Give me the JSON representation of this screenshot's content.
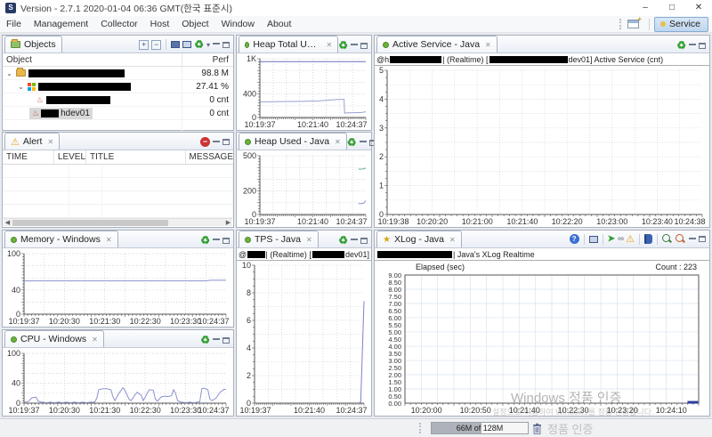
{
  "window": {
    "title": "Version - 2.7.1 2020-01-04 06:36 GMT(한국 표준시)"
  },
  "menu": {
    "items": [
      "File",
      "Management",
      "Collector",
      "Host",
      "Object",
      "Window",
      "About"
    ]
  },
  "perspective": {
    "service_label": "Service"
  },
  "objects_panel": {
    "tab": "Objects",
    "columns": {
      "object": "Object",
      "perf": "Perf"
    },
    "rows": [
      {
        "perf": "98.8 M"
      },
      {
        "perf": "27.41 %"
      },
      {
        "perf": "0 cnt"
      },
      {
        "label_suffix": "hdev01",
        "perf": "0 cnt"
      }
    ]
  },
  "alert_panel": {
    "tab": "Alert",
    "columns": [
      "TIME",
      "LEVEL",
      "TITLE",
      "MESSAGE"
    ]
  },
  "status_bar": {
    "memory_label": "66M of 128M"
  },
  "watermark": {
    "line1": "Windows 정품 인증",
    "line2": "설정으로 이동하여 Windows를 정품 인증합니다.",
    "line3": "정품 인증"
  },
  "chart_data": {
    "memory": {
      "type": "line",
      "title": "Memory - Windows",
      "ylim": [
        0,
        100
      ],
      "yticks": [
        {
          "v": 0,
          "t": "0"
        },
        {
          "v": 40,
          "t": "40"
        },
        {
          "v": 100,
          "t": "100"
        }
      ],
      "xlabels": [
        {
          "p": 0,
          "t": "10:19:37"
        },
        {
          "p": 0.2,
          "t": "10:20:30"
        },
        {
          "p": 0.4,
          "t": "10:21:30"
        },
        {
          "p": 0.6,
          "t": "10:22:30"
        },
        {
          "p": 0.8,
          "t": "10:23:30"
        },
        {
          "p": 1,
          "t": "10:24:37"
        }
      ],
      "margins": {
        "l": 24,
        "r": 8,
        "t": 6,
        "b": 14
      },
      "grid": {
        "vx": [
          0.1,
          0.2,
          0.3,
          0.4,
          0.5,
          0.6,
          0.7,
          0.8,
          0.9
        ],
        "hy": [
          0.2,
          0.4,
          0.6,
          0.8,
          1
        ],
        "color": "#cbcbcb",
        "dash": "1,2"
      },
      "minor_x": true,
      "minor_y": true,
      "series": [
        {
          "name": "memory-used-percent",
          "color": "#8a93cc",
          "lw": 1,
          "x": [
            0,
            0.9,
            0.92,
            1
          ],
          "y": [
            55,
            55,
            56,
            56
          ]
        }
      ]
    },
    "cpu": {
      "type": "line",
      "title": "CPU - Windows",
      "ylim": [
        0,
        100
      ],
      "yticks": [
        {
          "v": 0,
          "t": "0"
        },
        {
          "v": 40,
          "t": "40"
        },
        {
          "v": 100,
          "t": "100"
        }
      ],
      "xlabels": [
        {
          "p": 0,
          "t": "10:19:37"
        },
        {
          "p": 0.2,
          "t": "10:20:30"
        },
        {
          "p": 0.4,
          "t": "10:21:30"
        },
        {
          "p": 0.6,
          "t": "10:22:30"
        },
        {
          "p": 0.8,
          "t": "10:23:30"
        },
        {
          "p": 1,
          "t": "10:24:37"
        }
      ],
      "margins": {
        "l": 24,
        "r": 8,
        "t": 6,
        "b": 14
      },
      "grid": {
        "vx": [
          0.1,
          0.2,
          0.3,
          0.4,
          0.5,
          0.6,
          0.7,
          0.8,
          0.9
        ],
        "hy": [
          0.2,
          0.4,
          0.6,
          0.8,
          1
        ],
        "color": "#cbcbcb",
        "dash": "1,2"
      },
      "minor_x": true,
      "minor_y": true,
      "series": [
        {
          "name": "cpu-percent",
          "color": "#8a93cc",
          "lw": 1,
          "x": [
            0,
            0.02,
            0.04,
            0.06,
            0.07,
            0.09,
            0.11,
            0.13,
            0.15,
            0.17,
            0.19,
            0.21,
            0.23,
            0.25,
            0.27,
            0.29,
            0.31,
            0.33,
            0.35,
            0.36,
            0.37,
            0.39,
            0.41,
            0.43,
            0.44,
            0.45,
            0.47,
            0.49,
            0.5,
            0.52,
            0.53,
            0.55,
            0.56,
            0.58,
            0.59,
            0.61,
            0.62,
            0.64,
            0.65,
            0.66,
            0.68,
            0.7,
            0.71,
            0.73,
            0.74,
            0.75,
            0.76,
            0.78,
            0.8,
            0.82,
            0.84,
            0.86,
            0.87,
            0.88,
            0.89,
            0.91,
            0.92,
            0.93,
            0.95,
            0.97,
            0.99,
            1
          ],
          "y": [
            2,
            3,
            11,
            12,
            4,
            2,
            1,
            2,
            1,
            2,
            1,
            2,
            1,
            2,
            1,
            2,
            1,
            2,
            2,
            10,
            27,
            29,
            29,
            27,
            13,
            5,
            20,
            31,
            25,
            8,
            5,
            17,
            22,
            16,
            5,
            20,
            27,
            26,
            8,
            4,
            13,
            14,
            13,
            15,
            27,
            20,
            5,
            2,
            1,
            2,
            1,
            2,
            3,
            29,
            30,
            27,
            8,
            5,
            10,
            22,
            28,
            27
          ]
        }
      ]
    },
    "heap_total": {
      "type": "line",
      "title": "Heap Total Usage - Java",
      "ylim": [
        0,
        1000
      ],
      "yticks": [
        {
          "v": 0,
          "t": "0"
        },
        {
          "v": 400,
          "t": "400"
        },
        {
          "v": 1000,
          "t": "1K"
        }
      ],
      "xlabels": [
        {
          "p": 0,
          "t": "10:19:37"
        },
        {
          "p": 0.5,
          "t": "10:21:40"
        },
        {
          "p": 1,
          "t": "10:24:37"
        }
      ],
      "margins": {
        "l": 26,
        "r": 6,
        "t": 6,
        "b": 14
      },
      "grid": {
        "vx": [
          0.125,
          0.25,
          0.375,
          0.5,
          0.625,
          0.75,
          0.875
        ],
        "hy": [
          0.2,
          0.4,
          0.6,
          0.8,
          1
        ],
        "color": "#cbcbcb",
        "dash": "1,2"
      },
      "minor_x": true,
      "minor_y": true,
      "series": [
        {
          "name": "heap-max",
          "color": "#6a74bd",
          "lw": 1,
          "x": [
            0,
            1
          ],
          "y": [
            950,
            950
          ]
        },
        {
          "name": "heap-total",
          "color": "#98a0d0",
          "lw": 1,
          "x": [
            0,
            0.2,
            0.4,
            0.55,
            0.65,
            0.72,
            0.78,
            0.795,
            0.8,
            0.81,
            0.9,
            0.96,
            1
          ],
          "y": [
            265,
            270,
            275,
            282,
            295,
            305,
            308,
            308,
            74,
            78,
            82,
            86,
            96
          ]
        }
      ]
    },
    "heap_used": {
      "type": "line",
      "title": "Heap Used - Java",
      "ylim": [
        0,
        500
      ],
      "yticks": [
        {
          "v": 0,
          "t": "0"
        },
        {
          "v": 200,
          "t": "200"
        },
        {
          "v": 500,
          "t": "500"
        }
      ],
      "xlabels": [
        {
          "p": 0,
          "t": "10:19:37"
        },
        {
          "p": 0.5,
          "t": "10:21:40"
        },
        {
          "p": 1,
          "t": "10:24:37"
        }
      ],
      "margins": {
        "l": 26,
        "r": 6,
        "t": 6,
        "b": 14
      },
      "grid": {
        "vx": [
          0.125,
          0.25,
          0.375,
          0.5,
          0.625,
          0.75,
          0.875
        ],
        "hy": [
          0.2,
          0.4,
          0.6,
          0.8,
          1
        ],
        "color": "#cbcbcb",
        "dash": "1,2"
      },
      "minor_x": true,
      "minor_y": true,
      "series": [
        {
          "name": "heap-used-a",
          "color": "#5fb39b",
          "lw": 1,
          "x": [
            0.93,
            0.97,
            1
          ],
          "y": [
            385,
            387,
            394
          ]
        },
        {
          "name": "heap-used-b",
          "color": "#8a93cc",
          "lw": 1,
          "x": [
            0.93,
            0.96,
            0.98,
            1
          ],
          "y": [
            93,
            93,
            96,
            118
          ]
        }
      ]
    },
    "tps": {
      "type": "line",
      "title": "TPS - Java",
      "subtitle": {
        "a": "@",
        "b": " | (Realtime) [",
        "c": "dev01]"
      },
      "ylim": [
        0,
        10
      ],
      "yticks": [
        {
          "v": 0,
          "t": "0"
        },
        {
          "v": 2,
          "t": "2"
        },
        {
          "v": 4,
          "t": "4"
        },
        {
          "v": 6,
          "t": "6"
        },
        {
          "v": 8,
          "t": "8"
        },
        {
          "v": 10,
          "t": "10"
        }
      ],
      "xlabels": [
        {
          "p": 0,
          "t": "10:19:37"
        },
        {
          "p": 0.5,
          "t": "10:21:40"
        },
        {
          "p": 1,
          "t": "10:24:37"
        }
      ],
      "margins": {
        "l": 20,
        "r": 8,
        "t": 5,
        "b": 14
      },
      "grid": {
        "vx": [
          0.125,
          0.25,
          0.375,
          0.5,
          0.625,
          0.75,
          0.875
        ],
        "hy": [
          0.1,
          0.2,
          0.3,
          0.4,
          0.5,
          0.6,
          0.7,
          0.8,
          0.9,
          1
        ],
        "color": "#d2d2d2",
        "dash": "1,2"
      },
      "minor_x": true,
      "minor_y": true,
      "series": [
        {
          "name": "tps",
          "color": "#7b84c4",
          "lw": 1,
          "x": [
            0.955,
            0.97,
            1
          ],
          "y": [
            0,
            0.1,
            7.4
          ]
        }
      ]
    },
    "active_service": {
      "type": "line",
      "title": "Active Service - Java",
      "subtitle": {
        "a": "@h",
        "b": " | (Realtime) [",
        "c": "dev01] Active Service (cnt)"
      },
      "ylim": [
        0,
        5
      ],
      "yticks": [
        {
          "v": 0,
          "t": "0"
        },
        {
          "v": 1,
          "t": "1"
        },
        {
          "v": 2,
          "t": "2"
        },
        {
          "v": 3,
          "t": "3"
        },
        {
          "v": 4,
          "t": "4"
        },
        {
          "v": 5,
          "t": "5"
        }
      ],
      "xlabels": [
        {
          "p": 0,
          "t": "10:19:38"
        },
        {
          "p": 0.143,
          "t": "10:20:20"
        },
        {
          "p": 0.286,
          "t": "10:21:00"
        },
        {
          "p": 0.429,
          "t": "10:21:40"
        },
        {
          "p": 0.571,
          "t": "10:22:20"
        },
        {
          "p": 0.714,
          "t": "10:23:00"
        },
        {
          "p": 0.857,
          "t": "10:23:40"
        },
        {
          "p": 1,
          "t": "10:24:38"
        }
      ],
      "margins": {
        "l": 14,
        "r": 8,
        "t": 5,
        "b": 14
      },
      "grid": {
        "vx": [
          0.0714,
          0.1429,
          0.2143,
          0.2857,
          0.3571,
          0.4286,
          0.5,
          0.5714,
          0.6429,
          0.7143,
          0.7857,
          0.8571,
          0.9286
        ],
        "hy": [
          0.1,
          0.2,
          0.3,
          0.4,
          0.5,
          0.6,
          0.7,
          0.8,
          0.9,
          1
        ],
        "color": "#d2d2d2",
        "dash": "1,2"
      },
      "minor_x": true,
      "minor_y": true,
      "series": []
    },
    "xlog": {
      "type": "scatter",
      "title": "XLog - Java",
      "subtitle": {
        "b": " | Java's XLog Realtime"
      },
      "elapsed_label": "Elapsed (sec)",
      "count_label": "Count : 223",
      "ylim": [
        0,
        9
      ],
      "yfs": 7.5,
      "box": true,
      "yticks": [
        {
          "v": 9,
          "t": "9.00"
        },
        {
          "v": 8.5,
          "t": "8.50"
        },
        {
          "v": 8,
          "t": "8.00"
        },
        {
          "v": 7.5,
          "t": "7.50"
        },
        {
          "v": 7,
          "t": "7.00"
        },
        {
          "v": 6.5,
          "t": "6.50"
        },
        {
          "v": 6,
          "t": "6.00"
        },
        {
          "v": 5.5,
          "t": "5.50"
        },
        {
          "v": 5,
          "t": "5.00"
        },
        {
          "v": 4.5,
          "t": "4.50"
        },
        {
          "v": 4,
          "t": "4.00"
        },
        {
          "v": 3.5,
          "t": "3.50"
        },
        {
          "v": 3,
          "t": "3.00"
        },
        {
          "v": 2.5,
          "t": "2.50"
        },
        {
          "v": 2,
          "t": "2.00"
        },
        {
          "v": 1.5,
          "t": "1.50"
        },
        {
          "v": 1,
          "t": "1.00"
        },
        {
          "v": 0.5,
          "t": "0.50"
        },
        {
          "v": 0,
          "t": "0.00"
        }
      ],
      "xlabels": [
        {
          "p": 0.073,
          "t": "10:20:00"
        },
        {
          "p": 0.24,
          "t": "10:20:50"
        },
        {
          "p": 0.407,
          "t": "10:21:40"
        },
        {
          "p": 0.573,
          "t": "10:22:30"
        },
        {
          "p": 0.74,
          "t": "10:23:20"
        },
        {
          "p": 0.907,
          "t": "10:24:10"
        }
      ],
      "margins": {
        "l": 34,
        "r": 12,
        "t": 16,
        "b": 14
      },
      "grid": {
        "vx": [
          0.0556,
          0.1111,
          0.1667,
          0.2222,
          0.2778,
          0.3333,
          0.3889,
          0.4444,
          0.5,
          0.5556,
          0.6111,
          0.6667,
          0.7222,
          0.7778,
          0.8333,
          0.8889,
          0.9444
        ],
        "hy": [
          0.111,
          0.222,
          0.333,
          0.444,
          0.556,
          0.667,
          0.778,
          0.889
        ],
        "color": "#d9e3f2"
      },
      "minor_x": true,
      "minor_y": false,
      "series": [
        {
          "name": "xlog-recent-dots",
          "color": "#2b3f9e",
          "lw": 3,
          "x": [
            0.962,
            0.998
          ],
          "y": [
            0.06,
            0.06
          ]
        }
      ]
    }
  }
}
